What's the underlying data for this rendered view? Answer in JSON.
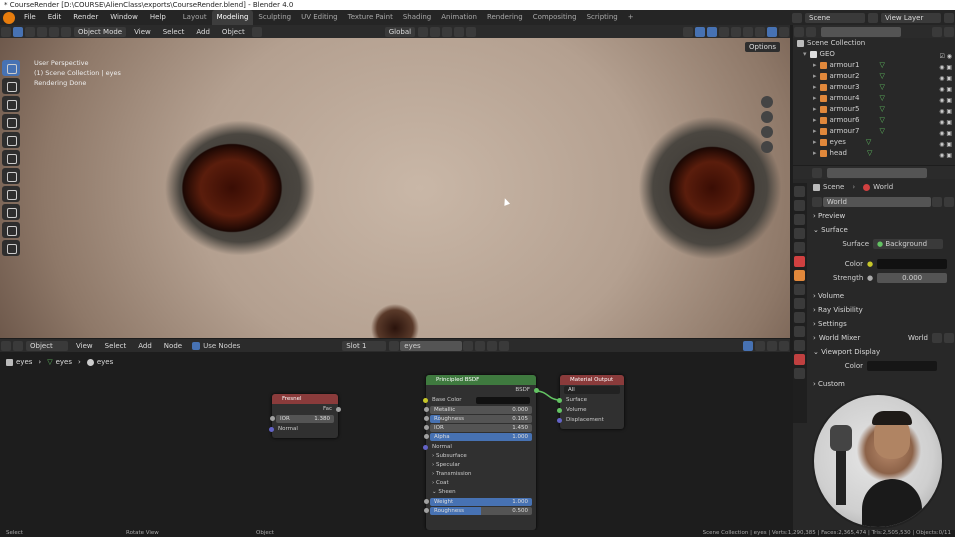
{
  "window": {
    "title": "* CourseRender [D:\\COURSE\\AlienClass\\exports\\CourseRender.blend] - Blender 4.0"
  },
  "menu": [
    "File",
    "Edit",
    "Render",
    "Window",
    "Help"
  ],
  "workspaces": [
    "Layout",
    "Modeling",
    "Sculpting",
    "UV Editing",
    "Texture Paint",
    "Shading",
    "Animation",
    "Rendering",
    "Compositing",
    "Scripting"
  ],
  "active_workspace": "Modeling",
  "scene_label": "Scene",
  "view_layer_label": "View Layer",
  "viewport": {
    "mode": "Object Mode",
    "menus": [
      "View",
      "Select",
      "Add",
      "Object"
    ],
    "orientation": "Global",
    "options_label": "Options",
    "overlay_line1": "User Perspective",
    "overlay_line2": "(1) Scene Collection | eyes",
    "overlay_line3": "Rendering Done"
  },
  "outliner": {
    "root": "Scene Collection",
    "collection": "GEO",
    "items": [
      "armour1",
      "armour2",
      "armour3",
      "armour4",
      "armour5",
      "armour6",
      "armour7",
      "eyes",
      "head"
    ]
  },
  "properties": {
    "breadcrumb_scene": "Scene",
    "breadcrumb_world": "World",
    "world_name": "World",
    "sections": {
      "preview": "Preview",
      "surface": "Surface",
      "volume": "Volume",
      "ray_visibility": "Ray Visibility",
      "settings": "Settings",
      "world_mixer": "World Mixer",
      "viewport_display": "Viewport Display",
      "custom": "Custom"
    },
    "surface_label": "Surface",
    "surface_value": "Background",
    "color_label": "Color",
    "strength_label": "Strength",
    "strength_value": "0.000",
    "world_mixer_value": "World",
    "vd_color_label": "Color"
  },
  "node_editor": {
    "mode": "Object",
    "menus": [
      "View",
      "Select",
      "Add",
      "Node"
    ],
    "use_nodes_label": "Use Nodes",
    "slot": "Slot 1",
    "material": "eyes",
    "breadcrumbs": [
      "eyes",
      "eyes",
      "eyes"
    ]
  },
  "nodes": {
    "fresnel": {
      "title": "Fresnel",
      "out": "Fac",
      "ior_label": "IOR",
      "ior_value": "1.380",
      "normal": "Normal"
    },
    "bsdf": {
      "title": "Principled BSDF",
      "out": "BSDF",
      "base_color": "Base Color",
      "metallic_label": "Metallic",
      "metallic_value": "0.000",
      "roughness_label": "Roughness",
      "roughness_value": "0.105",
      "ior_label": "IOR",
      "ior_value": "1.450",
      "alpha_label": "Alpha",
      "alpha_value": "1.000",
      "normal": "Normal",
      "subpanels": [
        "Subsurface",
        "Specular",
        "Transmission",
        "Coat",
        "Sheen"
      ],
      "weight_label": "Weight",
      "weight_value": "1.000",
      "sheen_roughness_label": "Roughness",
      "sheen_roughness_value": "0.500"
    },
    "output": {
      "title": "Material Output",
      "target": "All",
      "surface": "Surface",
      "volume": "Volume",
      "displacement": "Displacement"
    }
  },
  "statusbar": {
    "left1": "Select",
    "left2": "Rotate View",
    "left3": "Object",
    "right": "Scene Collection | eyes | Verts:1,290,385 | Faces:2,365,474 | Tris:2,505,530 | Objects:0/11"
  },
  "colors": {
    "accent": "#4772b3",
    "fresnel_header": "#8a3b3b",
    "bsdf_header": "#3f7a3f",
    "output_header": "#8a3b3b",
    "orange": "#e1883b"
  }
}
